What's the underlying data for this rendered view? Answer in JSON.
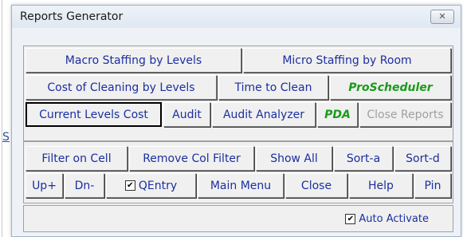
{
  "window": {
    "title": "Reports Generator",
    "close_glyph": "✕"
  },
  "background": {
    "fragment_letter": "S"
  },
  "row1": {
    "macro": "Macro Staffing by Levels",
    "micro": "Micro Staffing by Room"
  },
  "row2": {
    "cost_clean": "Cost of Cleaning by Levels",
    "time_clean": "Time to Clean",
    "proscheduler": "ProScheduler"
  },
  "row3": {
    "current_levels": "Current Levels Cost",
    "audit": "Audit",
    "audit_analyzer": "Audit Analyzer",
    "pda": "PDA",
    "close_reports": "Close Reports"
  },
  "row4": {
    "filter_cell": "Filter on Cell",
    "remove_col_filter": "Remove Col Filter",
    "show_all": "Show All",
    "sort_a": "Sort-a",
    "sort_d": "Sort-d"
  },
  "row5": {
    "up": "Up+",
    "dn": "Dn-",
    "qentry": "QEntry",
    "qentry_checked": true,
    "main_menu": "Main Menu",
    "close": "Close",
    "help": "Help",
    "pin": "Pin"
  },
  "footer": {
    "auto_activate": "Auto Activate",
    "auto_activate_checked": true
  },
  "icons": {
    "checkmark": "✔"
  },
  "colors": {
    "link_text": "#1b2fa0",
    "green_text": "#1a9b1a",
    "disabled_text": "#a0a0a0"
  }
}
